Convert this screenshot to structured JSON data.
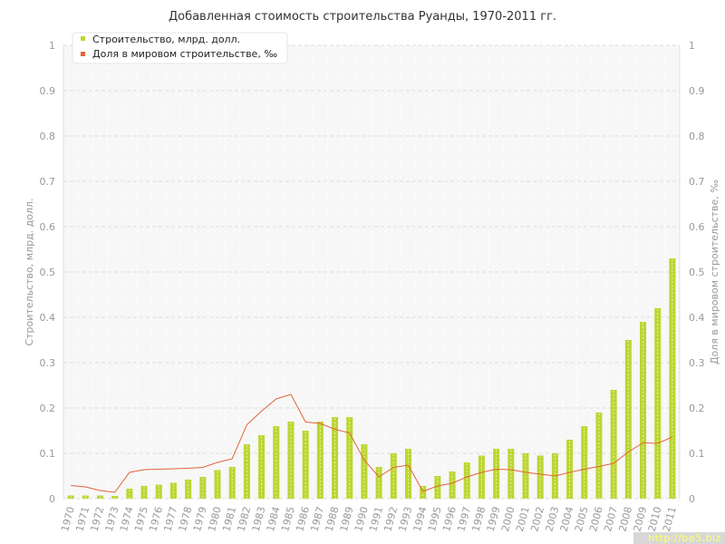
{
  "chart_data": {
    "type": "bar",
    "title": "Добавленная стоимость строительства Руанды, 1970-2011 гг.",
    "ylabel_left": "Строительство, млрд. долл.",
    "ylabel_right": "Доля в мировом строительстве, ‰",
    "ylim": [
      0,
      1
    ],
    "yticks": [
      "0",
      "0.1",
      "0.2",
      "0.3",
      "0.4",
      "0.5",
      "0.6",
      "0.7",
      "0.8",
      "0.9",
      "1"
    ],
    "categories": [
      "1970",
      "1971",
      "1972",
      "1973",
      "1974",
      "1975",
      "1976",
      "1977",
      "1978",
      "1979",
      "1980",
      "1981",
      "1982",
      "1983",
      "1984",
      "1985",
      "1986",
      "1987",
      "1988",
      "1989",
      "1990",
      "1991",
      "1992",
      "1993",
      "1994",
      "1995",
      "1996",
      "1997",
      "1998",
      "1999",
      "2000",
      "2001",
      "2002",
      "2003",
      "2004",
      "2005",
      "2006",
      "2007",
      "2008",
      "2009",
      "2010",
      "2011"
    ],
    "legend_position": "top-left",
    "grid": true,
    "series": [
      {
        "name": "Строительство, млрд. долл.",
        "kind": "bar",
        "axis": "left",
        "color": "#bcd631",
        "values": [
          0.007,
          0.007,
          0.007,
          0.006,
          0.022,
          0.028,
          0.031,
          0.035,
          0.042,
          0.048,
          0.063,
          0.07,
          0.12,
          0.14,
          0.16,
          0.17,
          0.15,
          0.17,
          0.18,
          0.18,
          0.12,
          0.07,
          0.1,
          0.11,
          0.028,
          0.05,
          0.06,
          0.08,
          0.095,
          0.11,
          0.11,
          0.1,
          0.095,
          0.1,
          0.13,
          0.16,
          0.19,
          0.24,
          0.35,
          0.39,
          0.42,
          0.53
        ]
      },
      {
        "name": "Доля в мировом строительстве, ‰",
        "kind": "line",
        "axis": "right",
        "color": "#e2643a",
        "values": [
          0.029,
          0.026,
          0.018,
          0.014,
          0.058,
          0.064,
          0.065,
          0.066,
          0.067,
          0.069,
          0.08,
          0.088,
          0.163,
          0.193,
          0.22,
          0.23,
          0.169,
          0.166,
          0.153,
          0.145,
          0.085,
          0.048,
          0.069,
          0.074,
          0.016,
          0.028,
          0.034,
          0.048,
          0.058,
          0.065,
          0.064,
          0.058,
          0.054,
          0.05,
          0.058,
          0.065,
          0.071,
          0.078,
          0.103,
          0.123,
          0.122,
          0.136
        ]
      }
    ]
  },
  "watermark": "http://be5.biz"
}
